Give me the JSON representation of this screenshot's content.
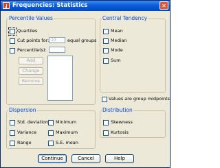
{
  "window": {
    "title": "Frequencies: Statistics",
    "close_glyph": "✕"
  },
  "percentile_values": {
    "legend": "Percentile Values",
    "quartiles": "Quartiles",
    "cut_points_prefix": "Cut points for:",
    "cut_points_value": "10",
    "cut_points_suffix": "equal groups",
    "percentiles": "Percentile(s):",
    "add": "Add",
    "change": "Change",
    "remove": "Remove"
  },
  "central_tendency": {
    "legend": "Central Tendency",
    "mean": "Mean",
    "median": "Median",
    "mode": "Mode",
    "sum": "Sum"
  },
  "group_midpoints": "Values are group midpoints",
  "dispersion": {
    "legend": "Dispersion",
    "std_deviation": "Std. deviation",
    "minimum": "Minimum",
    "variance": "Variance",
    "maximum": "Maximum",
    "range": "Range",
    "se_mean": "S.E. mean"
  },
  "distribution": {
    "legend": "Distribution",
    "skewness": "Skewness",
    "kurtosis": "Kurtosis"
  },
  "buttons": {
    "continue": "Continue",
    "cancel": "Cancel",
    "help": "Help"
  }
}
